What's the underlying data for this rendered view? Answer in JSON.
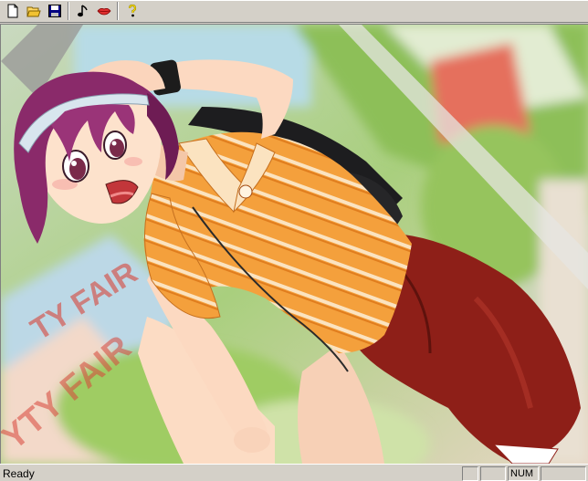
{
  "toolbar": {
    "buttons": [
      {
        "name": "new-file-icon"
      },
      {
        "name": "open-folder-icon"
      },
      {
        "name": "save-icon"
      },
      {
        "name": "music-note-icon"
      },
      {
        "name": "lips-icon"
      },
      {
        "name": "help-icon"
      }
    ]
  },
  "status": {
    "text": "Ready",
    "panes": [
      "",
      "",
      "NUM",
      ""
    ]
  },
  "colors": {
    "toolbar_bg": "#d4d0c8",
    "shirt": "#f4a03c",
    "shorts": "#8e1f18",
    "hair": "#8a2a6a",
    "foliage": "#8fc05a",
    "sign_red": "#d8453a"
  },
  "canvas": {
    "sign_text_1": "TY FAIR",
    "sign_text_2": "YTY FAIR"
  }
}
